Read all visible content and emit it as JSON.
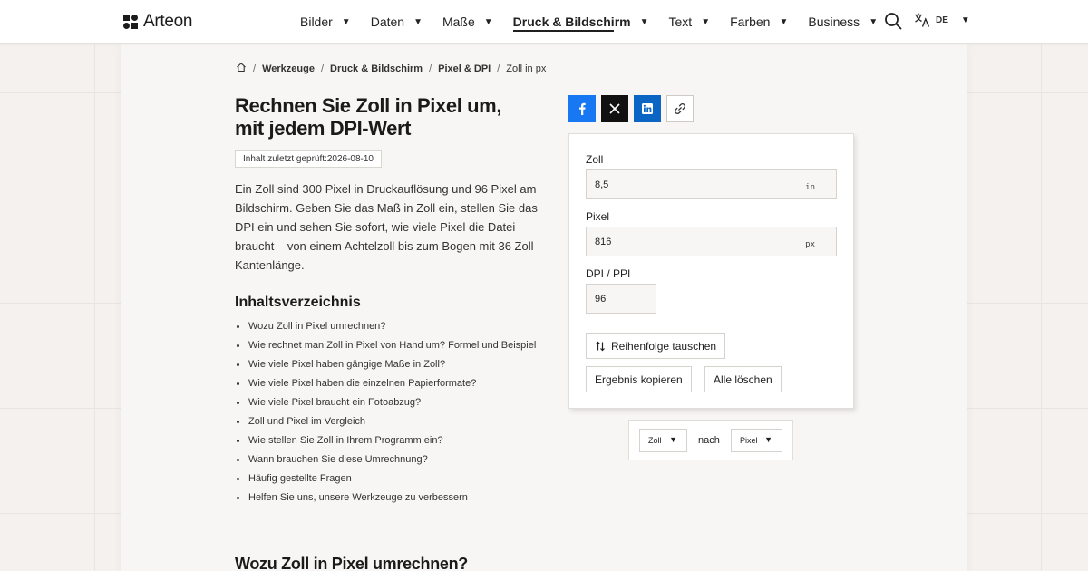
{
  "header": {
    "logo_text": "Arteon",
    "nav": [
      {
        "label": "Bilder",
        "active": false
      },
      {
        "label": "Daten",
        "active": false
      },
      {
        "label": "Maße",
        "active": false
      },
      {
        "label": "Druck & Bildschirm",
        "active": true
      },
      {
        "label": "Text",
        "active": false
      },
      {
        "label": "Farben",
        "active": false
      },
      {
        "label": "Business",
        "active": false
      }
    ],
    "language": "DE",
    "caret": "▼"
  },
  "breadcrumb": {
    "sep": "/",
    "items": [
      "Werkzeuge",
      "Druck & Bildschirm",
      "Pixel & DPI",
      "Zoll in px"
    ]
  },
  "article": {
    "title": "Rechnen Sie Zoll in Pixel um, mit jedem DPI-Wert",
    "reviewed": "Inhalt zuletzt geprüft:2026-08-10",
    "intro": "Ein Zoll sind 300 Pixel in Druckauflösung und 96 Pixel am Bildschirm. Geben Sie das Maß in Zoll ein, stellen Sie das DPI ein und sehen Sie sofort, wie viele Pixel die Datei braucht – von einem Achtelzoll bis zum Bogen mit 36 Zoll Kantenlänge.",
    "toc_title": "Inhaltsverzeichnis",
    "toc": [
      "Wozu Zoll in Pixel umrechnen?",
      "Wie rechnet man Zoll in Pixel von Hand um? Formel und Beispiel",
      "Wie viele Pixel haben gängige Maße in Zoll?",
      "Wie viele Pixel haben die einzelnen Papierformate?",
      "Wie viele Pixel braucht ein Fotoabzug?",
      "Zoll und Pixel im Vergleich",
      "Wie stellen Sie Zoll in Ihrem Programm ein?",
      "Wann brauchen Sie diese Umrechnung?",
      "Häufig gestellte Fragen",
      "Helfen Sie uns, unsere Werkzeuge zu verbessern"
    ],
    "section_heading": "Wozu Zoll in Pixel umrechnen?"
  },
  "share": {
    "icons": [
      "facebook-icon",
      "x-icon",
      "linkedin-icon",
      "link-icon"
    ]
  },
  "calculator": {
    "inch_label": "Zoll",
    "inch_value": "8,5",
    "inch_unit": "in",
    "pixel_label": "Pixel",
    "pixel_value": "816",
    "pixel_unit": "px",
    "dpi_label": "DPI / PPI",
    "dpi_value": "96",
    "swap_label": "Reihenfolge tauschen",
    "copy_label": "Ergebnis kopieren",
    "clear_label": "Alle löschen"
  },
  "converter": {
    "from": "Zoll",
    "word": "nach",
    "to": "Pixel"
  },
  "colors": {
    "facebook": "#1877f2",
    "x": "#111111",
    "linkedin": "#0a66c2",
    "background": "#f4f1ee"
  }
}
